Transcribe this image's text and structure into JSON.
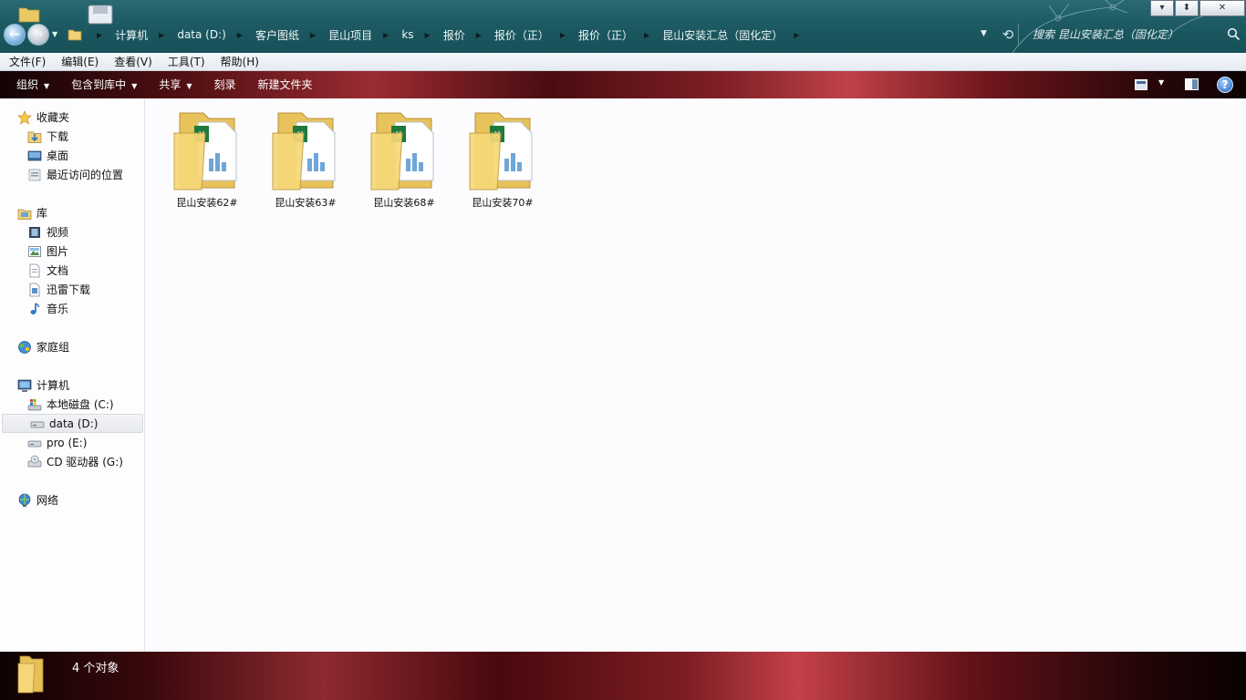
{
  "window": {
    "controls": {
      "minimize": "▾",
      "maximize": "⬍",
      "close": "✕"
    }
  },
  "address": {
    "crumbs": [
      "计算机",
      "data (D:)",
      "客户图纸",
      "昆山项目",
      "ks",
      "报价",
      "报价（正）",
      "报价（正）",
      "昆山安装汇总（固化定）"
    ],
    "search_placeholder": "搜索 昆山安装汇总（固化定）"
  },
  "menu": [
    "文件(F)",
    "编辑(E)",
    "查看(V)",
    "工具(T)",
    "帮助(H)"
  ],
  "toolbar": {
    "organize": "组织",
    "include_library": "包含到库中",
    "share": "共享",
    "burn": "刻录",
    "new_folder": "新建文件夹",
    "help": "?"
  },
  "sidebar": {
    "favorites": {
      "label": "收藏夹",
      "items": [
        "下载",
        "桌面",
        "最近访问的位置"
      ]
    },
    "libraries": {
      "label": "库",
      "items": [
        "视频",
        "图片",
        "文档",
        "迅雷下载",
        "音乐"
      ]
    },
    "homegroup": {
      "label": "家庭组"
    },
    "computer": {
      "label": "计算机",
      "items": [
        "本地磁盘 (C:)",
        "data (D:)",
        "pro (E:)",
        "CD 驱动器 (G:)"
      ],
      "selected": "data (D:)"
    },
    "network": {
      "label": "网络"
    }
  },
  "files": [
    {
      "name": "昆山安装62#"
    },
    {
      "name": "昆山安装63#"
    },
    {
      "name": "昆山安装68#"
    },
    {
      "name": "昆山安装70#"
    }
  ],
  "status": {
    "count_text": "4 个对象"
  },
  "colors": {
    "titlebar": "#1d5a63",
    "toolbar_accent": "#c04148",
    "selection": "#e7e9ec",
    "folder": "#f3d37a"
  }
}
